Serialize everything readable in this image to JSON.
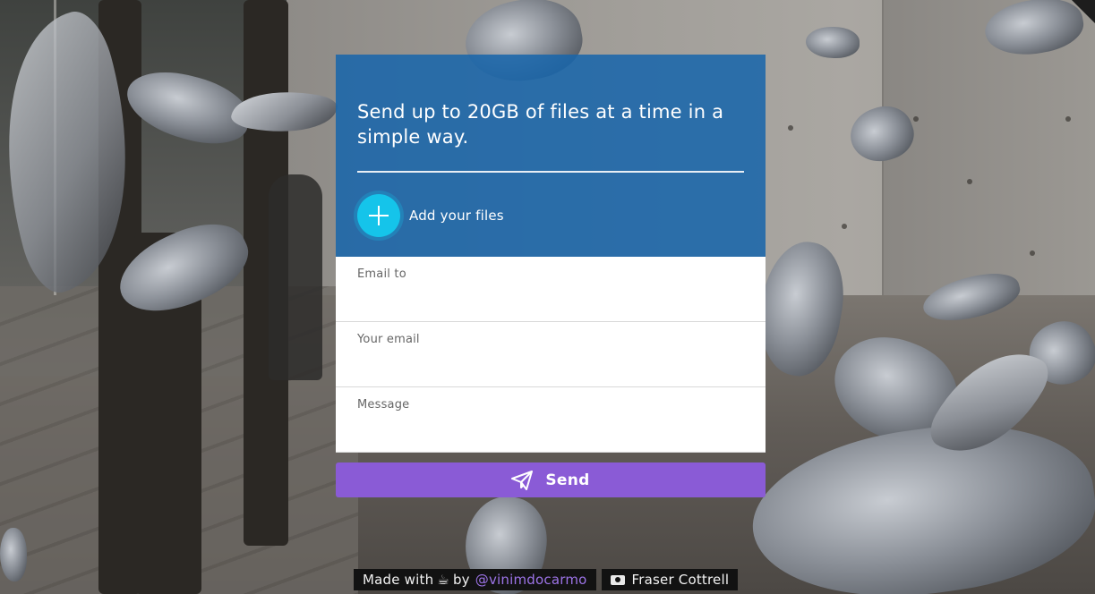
{
  "card": {
    "headline": "Send up to 20GB of files at a time in a simple way.",
    "add_files_label": "Add your files",
    "fields": [
      {
        "label": "Email to",
        "value": ""
      },
      {
        "label": "Your email",
        "value": ""
      },
      {
        "label": "Message",
        "value": ""
      }
    ],
    "send_label": "Send"
  },
  "footer": {
    "made_with": "Made with",
    "cup_glyph": "☕",
    "by": "by",
    "author_handle": "@vinimdocarmo",
    "photo_credit": "Fraser Cottrell"
  },
  "colors": {
    "header_bg": "#1765ab",
    "add_button": "#15c4ea",
    "send_button": "#8a5bd6",
    "handle_link": "#9d74e8",
    "footer_bg": "#121212"
  },
  "icons": {
    "add": "plus-icon",
    "send": "paper-plane-icon",
    "credit": "camera-icon",
    "cup": "coffee-icon"
  }
}
